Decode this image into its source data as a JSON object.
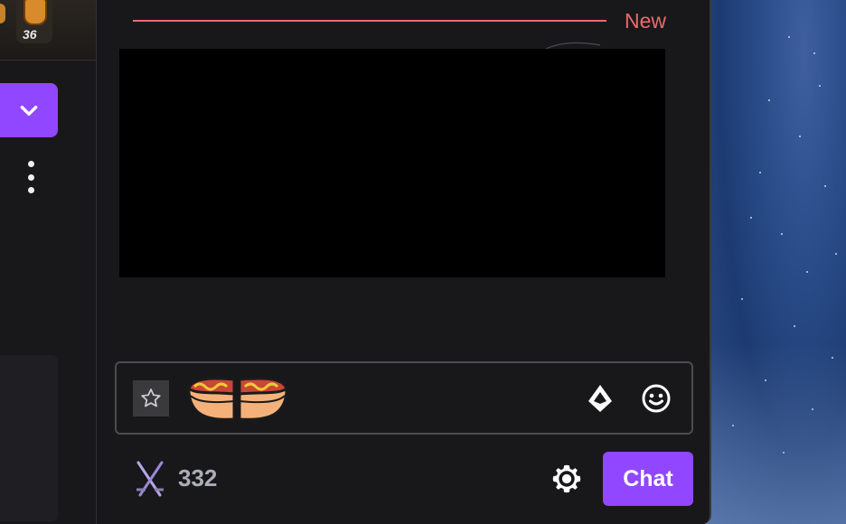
{
  "left_panel": {
    "badge_count": "36"
  },
  "chat": {
    "new_divider_label": "New",
    "chat_button_label": "Chat",
    "channel_points": "332"
  },
  "icons": {
    "dropdown": "chevron-down-icon",
    "more": "kebab-icon",
    "favorite": "star-icon",
    "emote": "hotdog-emote",
    "bits": "bits-icon",
    "emoji": "smiley-icon",
    "points": "crossed-swords-icon",
    "settings": "gear-icon"
  },
  "colors": {
    "accent": "#9147ff",
    "new_divider": "#eb6b6b",
    "panel_bg": "#18181b"
  }
}
